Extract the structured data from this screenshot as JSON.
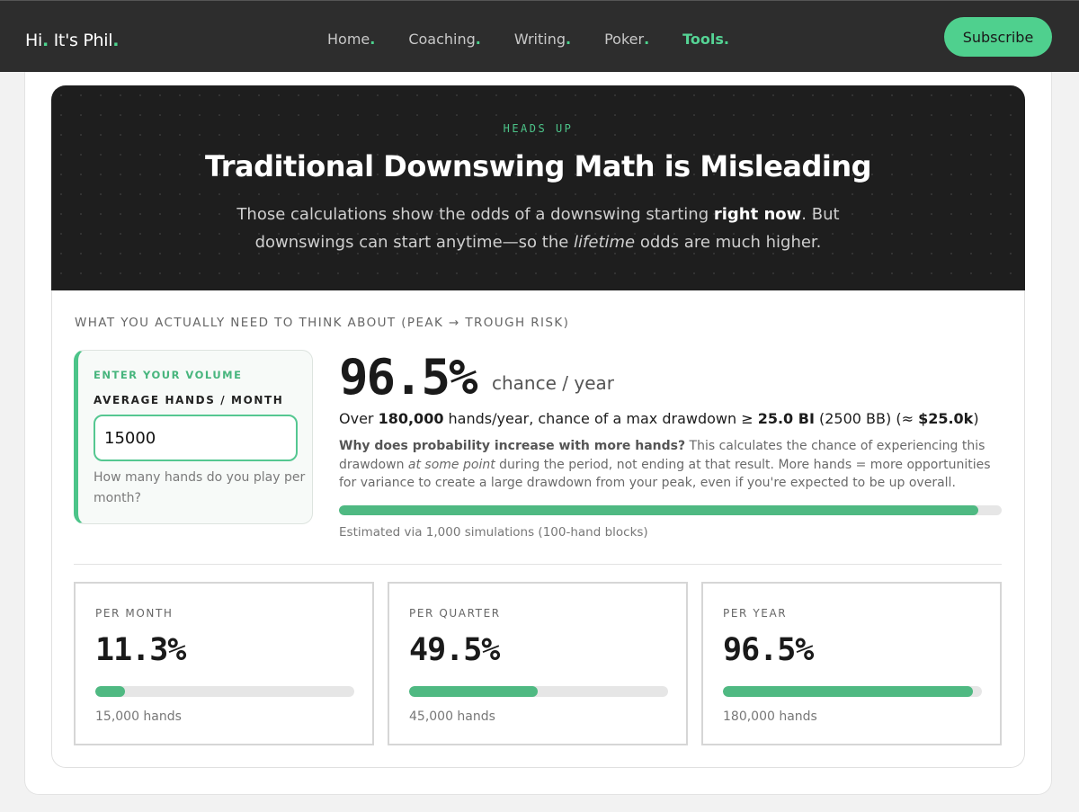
{
  "nav": {
    "brand": {
      "hi": "Hi",
      "dot1": ".",
      "name": " It's Phil",
      "dot2": "."
    },
    "items": [
      {
        "label": "Home",
        "dot": "."
      },
      {
        "label": "Coaching",
        "dot": "."
      },
      {
        "label": "Writing",
        "dot": "."
      },
      {
        "label": "Poker",
        "dot": "."
      },
      {
        "label": "Tools",
        "dot": ".",
        "active": true
      }
    ],
    "subscribe": "Subscribe"
  },
  "hero": {
    "eyebrow": "HEADS UP",
    "title": "Traditional Downswing Math is Misleading",
    "text_1": "Those calculations show the odds of a downswing starting ",
    "text_bold": "right now",
    "text_2": ". But downswings can start anytime—so the ",
    "text_italic": "lifetime",
    "text_3": " odds are much higher."
  },
  "section_title": "WHAT YOU ACTUALLY NEED TO THINK ABOUT (PEAK → TROUGH RISK)",
  "volume": {
    "eyebrow": "ENTER YOUR VOLUME",
    "label": "AVERAGE HANDS / MONTH",
    "value": "15000",
    "help": "How many hands do you play per month?"
  },
  "result": {
    "pct": "96.5%",
    "suffix": "chance / year",
    "summary_1": "Over ",
    "hands": "180,000",
    "summary_2": " hands/year, chance of a max drawdown ≥ ",
    "bi": "25.0 BI",
    "summary_3": " (2500 BB) (≈ ",
    "dollars": "$25.0k",
    "summary_4": ")",
    "explain_q": "Why does probability increase with more hands?",
    "explain_1": " This calculates the chance of experiencing this drawdown ",
    "explain_italic": "at some point",
    "explain_2": " during the period, not ending at that result. More hands = more opportunities for variance to create a large drawdown from your peak, even if you're expected to be up overall.",
    "progress": 0.965,
    "caption": "Estimated via 1,000 simulations (100-hand blocks)"
  },
  "stats": [
    {
      "label": "PER MONTH",
      "value": "11.3%",
      "progress": 0.113,
      "hands": "15,000 hands"
    },
    {
      "label": "PER QUARTER",
      "value": "49.5%",
      "progress": 0.495,
      "hands": "45,000 hands"
    },
    {
      "label": "PER YEAR",
      "value": "96.5%",
      "progress": 0.965,
      "hands": "180,000 hands"
    }
  ],
  "colors": {
    "accent": "#4fd08e",
    "bar": "#4fb982",
    "nav_bg": "#2d2d2d",
    "hero_bg": "#1e1e1e"
  }
}
